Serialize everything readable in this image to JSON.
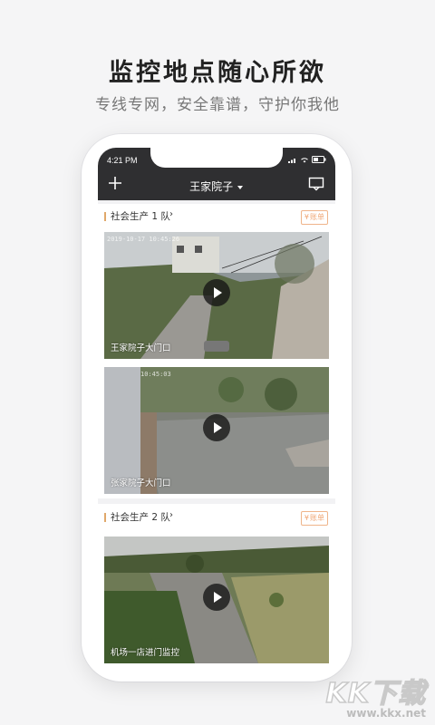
{
  "promo": {
    "headline": "监控地点随心所欲",
    "subline": "专线专网，安全靠谱，守护你我他"
  },
  "status_bar": {
    "time": "4:21 PM"
  },
  "header": {
    "title": "王家院子",
    "dropdown_icon": "caret-down-icon",
    "left_icon": "plus-icon",
    "right_icon": "message-icon"
  },
  "sections": [
    {
      "title": "社会生产 1 队",
      "bill_label": "账单",
      "cameras": [
        {
          "label": "王家院子大门口",
          "timestamp": "2019-10-17  10:45:26"
        },
        {
          "label": "张家院子大门口",
          "timestamp": "10:45:03"
        }
      ]
    },
    {
      "title": "社会生产 2 队",
      "bill_label": "账单",
      "cameras": [
        {
          "label": "机场一店进门监控",
          "timestamp": ""
        }
      ]
    }
  ],
  "watermark": {
    "brand": "KK下载",
    "url": "www.kkx.net"
  },
  "colors": {
    "accent": "#e0a86a",
    "topbar": "#2f2f31"
  }
}
